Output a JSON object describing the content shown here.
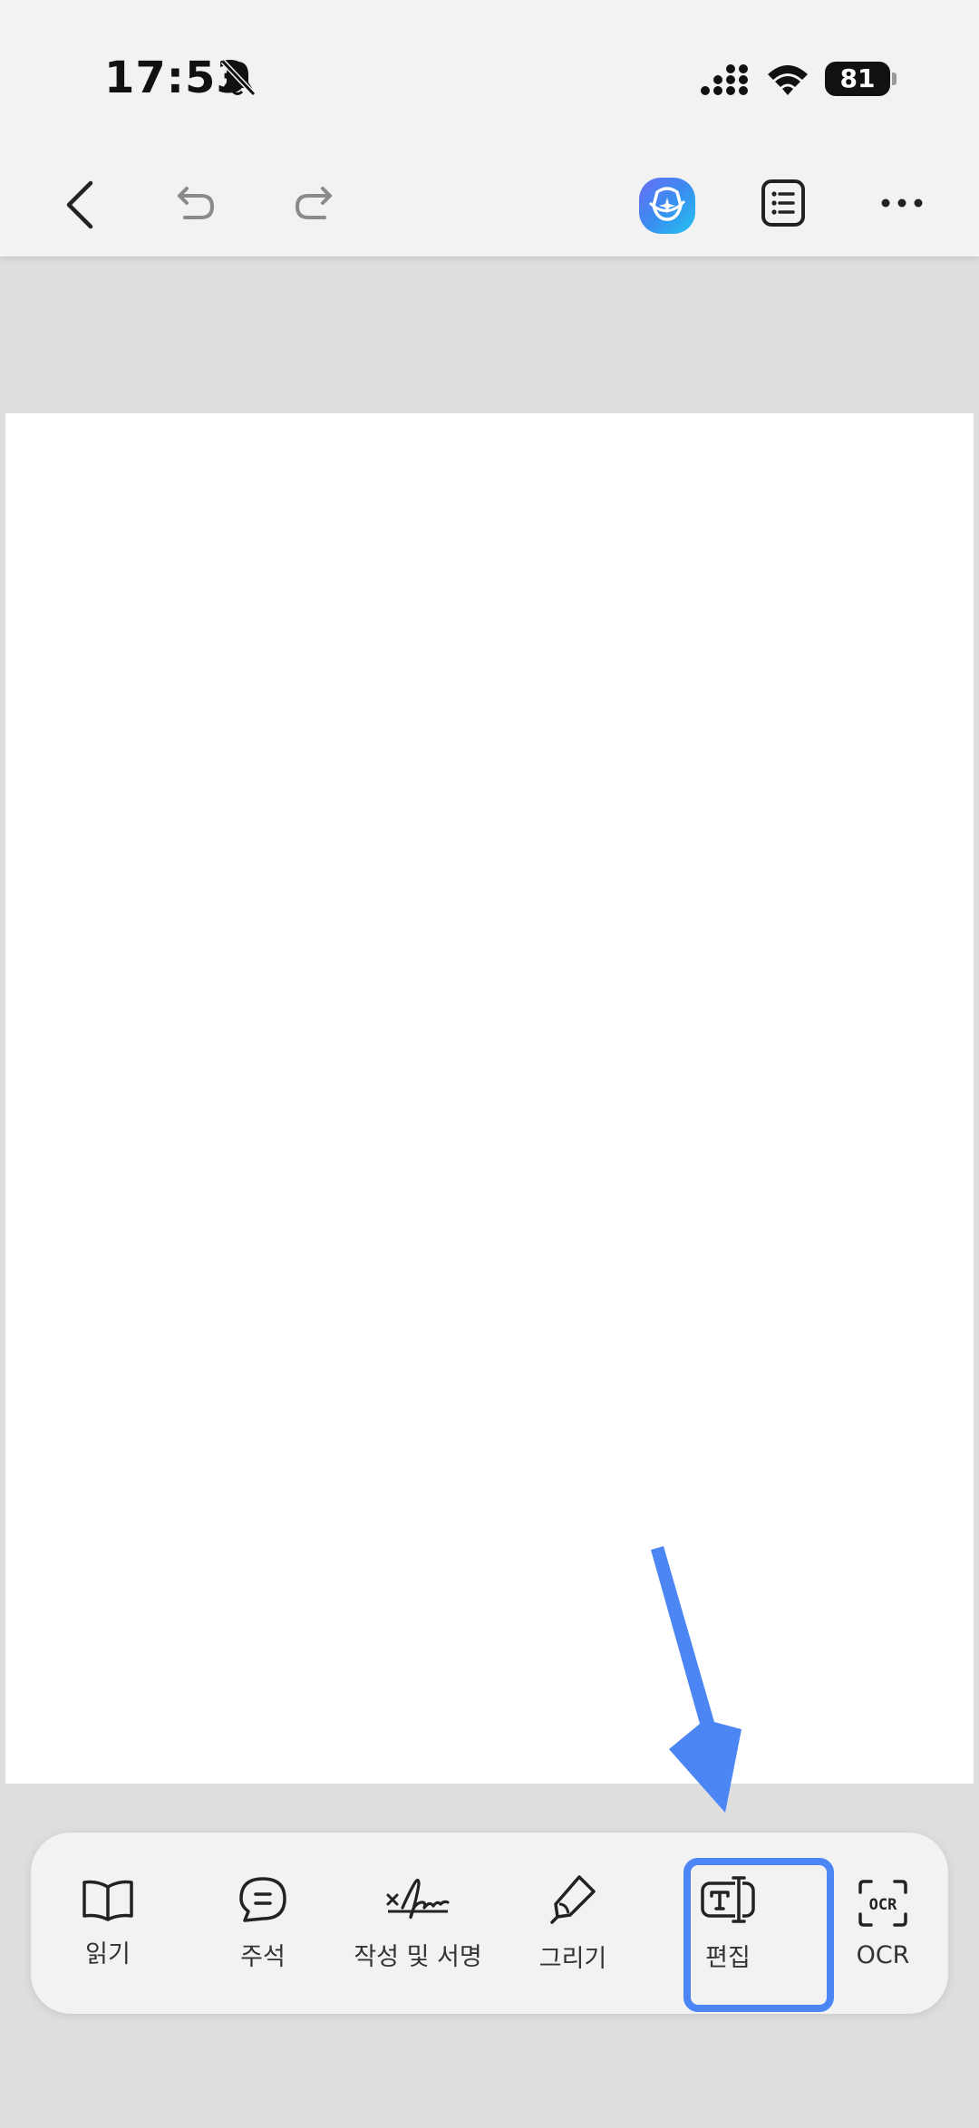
{
  "status_bar": {
    "time": "17:53",
    "battery": "81"
  },
  "header": {
    "icons": [
      "back-icon",
      "undo-icon",
      "redo-icon",
      "ai-assistant-icon",
      "list-icon",
      "more-icon"
    ]
  },
  "toolbar": {
    "items": [
      {
        "label": "읽기",
        "icon": "book-icon"
      },
      {
        "label": "주석",
        "icon": "comment-icon"
      },
      {
        "label": "작성 및 서명",
        "icon": "signature-icon"
      },
      {
        "label": "그리기",
        "icon": "pen-icon"
      },
      {
        "label": "편집",
        "icon": "text-edit-icon",
        "highlighted": true
      },
      {
        "label": "OCR",
        "icon": "ocr-icon"
      }
    ]
  },
  "colors": {
    "highlight": "#4c86f4",
    "ai_icon": "#3a8df0"
  }
}
